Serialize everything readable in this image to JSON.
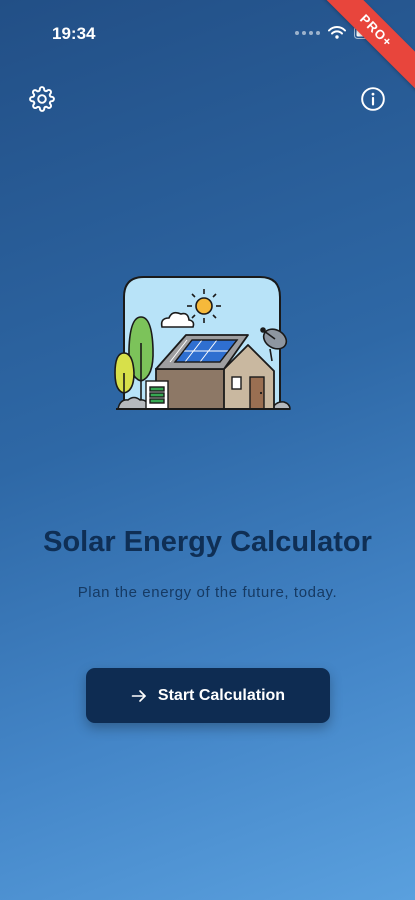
{
  "status_bar": {
    "time": "19:34",
    "icons": [
      "signal-dots-icon",
      "wifi-icon",
      "battery-icon"
    ]
  },
  "banner": {
    "text": "PRO+",
    "color": "#e8453c"
  },
  "top_bar": {
    "left_icon": "gear-icon",
    "right_icon": "info-icon"
  },
  "illustration": {
    "icon": "solar-house-illustration"
  },
  "main": {
    "title": "Solar Energy Calculator",
    "subtitle": "Plan the energy of the future, today."
  },
  "start_button": {
    "label": "Start Calculation",
    "icon": "arrow-right-icon"
  },
  "colors": {
    "gradient_top": "#224f86",
    "gradient_bottom": "#5aa0de",
    "button_bg": "#0e2c52",
    "title_text": "#0f2f55"
  }
}
